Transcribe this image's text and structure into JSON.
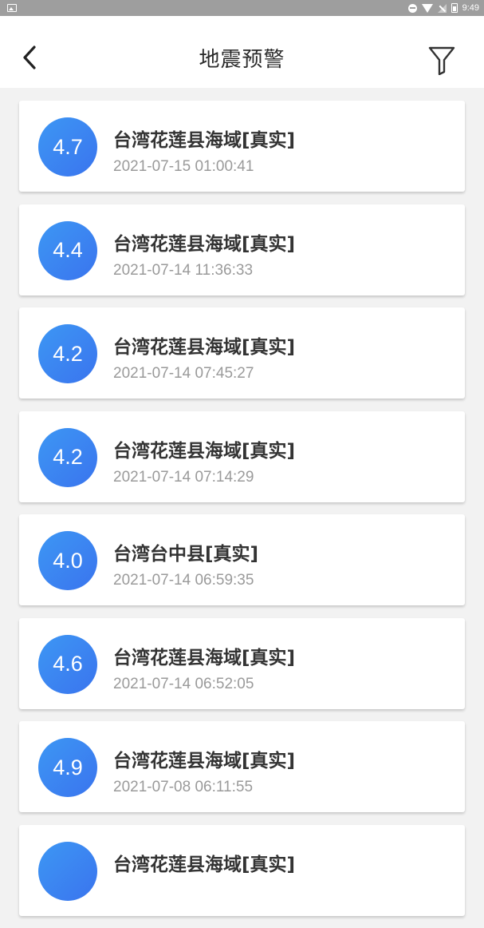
{
  "status_bar": {
    "time": "9:49"
  },
  "header": {
    "title": "地震预警"
  },
  "icons": {
    "back": "chevron-left-icon",
    "filter": "filter-icon"
  },
  "colors": {
    "magnitude_badge": "#3a80f0",
    "header_bg": "#ffffff",
    "page_bg": "#f2f2f2"
  },
  "events": [
    {
      "magnitude": "4.7",
      "location": "台湾花莲县海域[真实]",
      "time": "2021-07-15 01:00:41"
    },
    {
      "magnitude": "4.4",
      "location": "台湾花莲县海域[真实]",
      "time": "2021-07-14 11:36:33"
    },
    {
      "magnitude": "4.2",
      "location": "台湾花莲县海域[真实]",
      "time": "2021-07-14 07:45:27"
    },
    {
      "magnitude": "4.2",
      "location": "台湾花莲县海域[真实]",
      "time": "2021-07-14 07:14:29"
    },
    {
      "magnitude": "4.0",
      "location": "台湾台中县[真实]",
      "time": "2021-07-14 06:59:35"
    },
    {
      "magnitude": "4.6",
      "location": "台湾花莲县海域[真实]",
      "time": "2021-07-14 06:52:05"
    },
    {
      "magnitude": "4.9",
      "location": "台湾花莲县海域[真实]",
      "time": "2021-07-08 06:11:55"
    },
    {
      "magnitude": "",
      "location": "台湾花莲县海域[真实]",
      "time": ""
    }
  ]
}
